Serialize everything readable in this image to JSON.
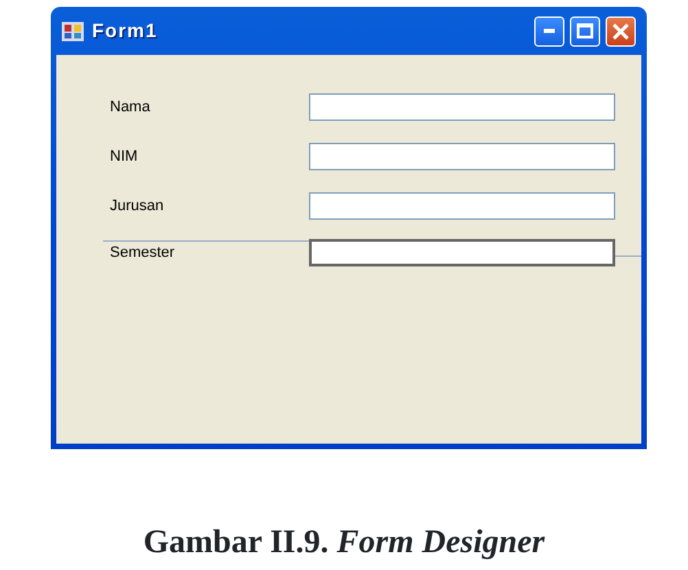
{
  "window": {
    "title": "Form1"
  },
  "fields": [
    {
      "label": "Nama",
      "selected": false
    },
    {
      "label": "NIM",
      "selected": false
    },
    {
      "label": "Jurusan",
      "selected": false
    },
    {
      "label": "Semester",
      "selected": true
    }
  ],
  "caption": {
    "number": "Gambar II.9.",
    "title": "Form Designer"
  }
}
